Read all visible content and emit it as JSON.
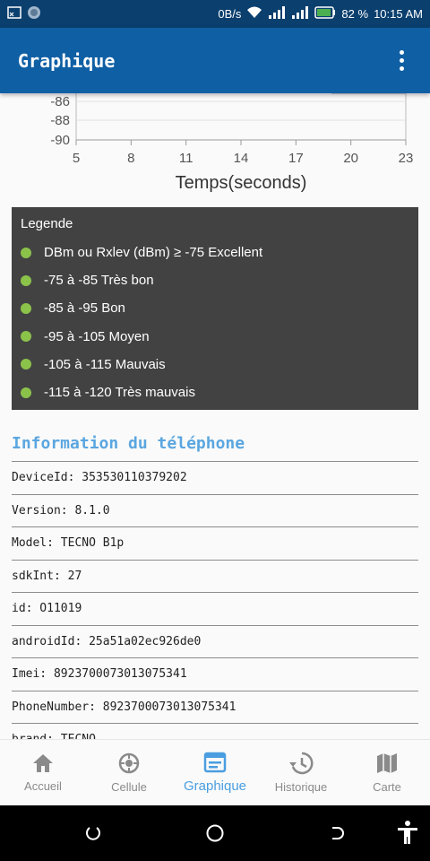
{
  "status_bar": {
    "net_speed": "0B/s",
    "battery_percent": "82 %",
    "time": "10:15 AM"
  },
  "app_bar": {
    "title": "Graphique"
  },
  "chart_data": {
    "type": "line",
    "xlabel": "Temps(seconds)",
    "x_ticks": [
      "5",
      "8",
      "11",
      "14",
      "17",
      "20",
      "23"
    ],
    "y_ticks": [
      "-86",
      "-88",
      "-90"
    ],
    "xlim": [
      5,
      23
    ],
    "ylim_visible": [
      -90,
      -86
    ]
  },
  "legend": {
    "title": "Legende",
    "items": [
      {
        "label": "DBm ou Rxlev (dBm) ≥ -75 Excellent"
      },
      {
        "label": "-75 à -85 Très bon"
      },
      {
        "label": " -85 à -95 Bon"
      },
      {
        "label": "-95 à -105 Moyen"
      },
      {
        "label": " -105 à -115 Mauvais"
      },
      {
        "label": " -115 à -120 Très mauvais"
      }
    ],
    "dot_color": "#8bc34a"
  },
  "info": {
    "title": "Information du téléphone",
    "rows": [
      "DeviceId: 353530110379202",
      "Version: 8.1.0",
      "Model: TECNO B1p",
      "sdkInt: 27",
      "id: O11019",
      "androidId: 25a51a02ec926de0",
      "Imei: 8923700073013075341",
      "PhoneNumber: 8923700073013075341",
      "brand: TECNO"
    ]
  },
  "bottom_nav": {
    "items": [
      {
        "label": "Accueil",
        "icon": "home-icon"
      },
      {
        "label": "Cellule",
        "icon": "cell-tower-icon"
      },
      {
        "label": "Graphique",
        "icon": "chart-icon"
      },
      {
        "label": "Historique",
        "icon": "history-icon"
      },
      {
        "label": "Carte",
        "icon": "map-icon"
      }
    ],
    "active_index": 2,
    "active_color": "#4a9ee0"
  },
  "colors": {
    "status_bar": "#0a3f6e",
    "app_bar": "#0f5fa4",
    "legend_bg": "#424242",
    "info_title": "#5aa6e0"
  }
}
